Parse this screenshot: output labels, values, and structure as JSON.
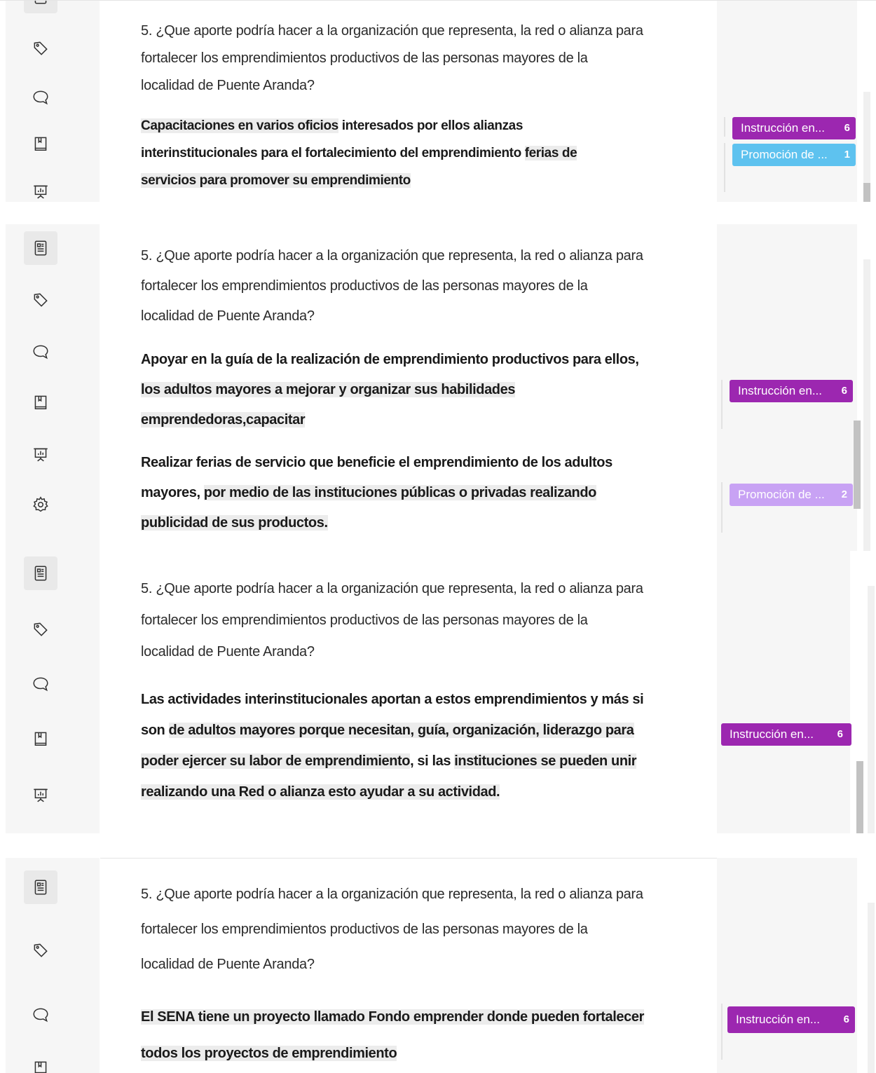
{
  "question": "5. ¿Que aporte podría hacer a la organización que representa, la red o alianza para fortalecer los emprendimientos productivos de las personas mayores de la localidad de Puente Aranda?",
  "question_lines": [
    "5. ¿Que aporte podría hacer a la organización que representa, la red o alianza para",
    "fortalecer los emprendimientos productivos de las personas mayores de la",
    "localidad de Puente Aranda?"
  ],
  "icons": [
    "document-icon",
    "tag-icon",
    "comment-icon",
    "book-icon",
    "presentation-icon",
    "gear-icon"
  ],
  "panel1": {
    "answer": {
      "l1a": "Capacitaciones en varios oficios",
      "l1b": " interesados por ellos alianzas",
      "l2a": "interinstitucionales para el fortalecimiento del emprendimiento ",
      "l2b": "ferias de",
      "l3": "servicios para promover su emprendimiento"
    },
    "tags": [
      {
        "label": "Instrucción en...",
        "count": "6",
        "color": "#9c27b0"
      },
      {
        "label": "Promoción de ...",
        "count": "1",
        "color": "#5ec2ef"
      }
    ]
  },
  "panel2": {
    "answer1": {
      "l1": "Apoyar en la guía de la realización de emprendimiento productivos para ellos,",
      "l2": "los adultos mayores a mejorar y organizar sus habilidades",
      "l3": "emprendedoras,capacitar"
    },
    "answer2": {
      "l1": "Realizar ferias de servicio que beneficie el emprendimiento de los adultos",
      "l2a": "mayores, ",
      "l2b": "por medio de las instituciones públicas o privadas realizando",
      "l3": "publicidad de sus productos."
    },
    "tags": [
      {
        "label": "Instrucción en...",
        "count": "6",
        "color": "#9c27b0"
      },
      {
        "label": "Promoción de ...",
        "count": "2",
        "color": "#c8a2f4"
      }
    ]
  },
  "panel3": {
    "answer": {
      "l1": "Las actividades interinstitucionales aportan a estos emprendimientos y más si",
      "l2a": "son ",
      "l2b": "de adultos mayores porque necesitan, guía, organización, liderazgo para",
      "l3a": "poder ejercer su labor de emprendimiento",
      "l3b": ", si las ",
      "l3c": "instituciones se pueden unir",
      "l4": "realizando una Red o alianza esto ayudar a su actividad."
    },
    "tags": [
      {
        "label": "Instrucción en...",
        "count": "6",
        "color": "#9c27b0"
      }
    ]
  },
  "panel4": {
    "answer": {
      "l1": "El SENA tiene un proyecto llamado Fondo emprender donde pueden fortalecer",
      "l2": "todos los proyectos de emprendimiento"
    },
    "tags": [
      {
        "label": "Instrucción en...",
        "count": "6",
        "color": "#9c27b0"
      }
    ]
  }
}
